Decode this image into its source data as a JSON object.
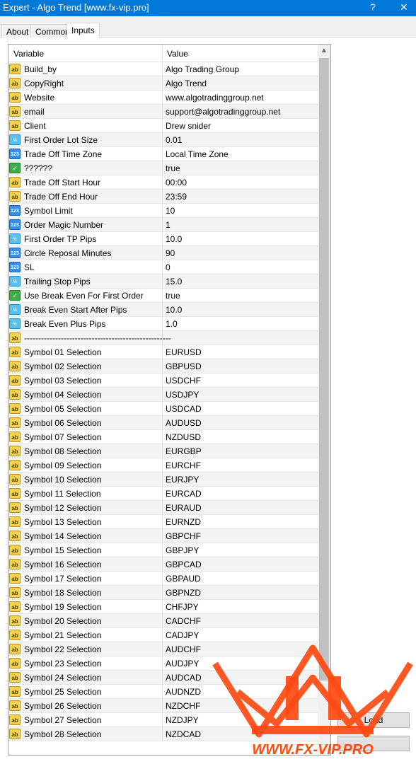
{
  "window": {
    "title": "Expert - Algo Trend [www.fx-vip.pro]",
    "help_glyph": "?",
    "close_glyph": "✕"
  },
  "tabs": [
    {
      "label": "About"
    },
    {
      "label": "Common"
    },
    {
      "label": "Inputs",
      "active": true
    }
  ],
  "grid": {
    "columns": [
      "Variable",
      "Value"
    ],
    "rows": [
      {
        "icon": "ab",
        "variable": "Build_by",
        "value": "Algo Trading Group"
      },
      {
        "icon": "ab",
        "variable": "CopyRight",
        "value": "Algo Trend"
      },
      {
        "icon": "ab",
        "variable": "Website",
        "value": "www.algotradinggroup.net"
      },
      {
        "icon": "ab",
        "variable": "email",
        "value": "support@algotradinggroup.net"
      },
      {
        "icon": "ab",
        "variable": "Client",
        "value": "Drew snider"
      },
      {
        "icon": "dbl",
        "variable": "First Order Lot Size",
        "value": "0.01"
      },
      {
        "icon": "num",
        "variable": "Trade Off Time Zone",
        "value": "Local Time Zone"
      },
      {
        "icon": "bool",
        "variable": "??????",
        "value": "true"
      },
      {
        "icon": "ab",
        "variable": "Trade Off Start Hour",
        "value": "00:00"
      },
      {
        "icon": "ab",
        "variable": "Trade Off End Hour",
        "value": "23:59"
      },
      {
        "icon": "num",
        "variable": "Symbol Limit",
        "value": "10"
      },
      {
        "icon": "num",
        "variable": "Order Magic Number",
        "value": "1"
      },
      {
        "icon": "dbl",
        "variable": "First Order TP Pips",
        "value": "10.0"
      },
      {
        "icon": "num",
        "variable": "Circle Reposal Minutes",
        "value": "90"
      },
      {
        "icon": "num",
        "variable": "SL",
        "value": "0"
      },
      {
        "icon": "dbl",
        "variable": "Trailing Stop Pips",
        "value": "15.0"
      },
      {
        "icon": "bool",
        "variable": "Use Break Even For First Order",
        "value": "true"
      },
      {
        "icon": "dbl",
        "variable": "Break Even Start After Pips",
        "value": "10.0"
      },
      {
        "icon": "dbl",
        "variable": "Break Even Plus Pips",
        "value": "1.0"
      },
      {
        "icon": "ab",
        "variable": "----------------------------------------------------",
        "value": ""
      },
      {
        "icon": "ab",
        "variable": "Symbol 01 Selection",
        "value": "EURUSD"
      },
      {
        "icon": "ab",
        "variable": "Symbol 02 Selection",
        "value": "GBPUSD"
      },
      {
        "icon": "ab",
        "variable": "Symbol 03 Selection",
        "value": "USDCHF"
      },
      {
        "icon": "ab",
        "variable": "Symbol 04 Selection",
        "value": "USDJPY"
      },
      {
        "icon": "ab",
        "variable": "Symbol 05 Selection",
        "value": "USDCAD"
      },
      {
        "icon": "ab",
        "variable": "Symbol 06 Selection",
        "value": "AUDUSD"
      },
      {
        "icon": "ab",
        "variable": "Symbol 07 Selection",
        "value": "NZDUSD"
      },
      {
        "icon": "ab",
        "variable": "Symbol 08 Selection",
        "value": "EURGBP"
      },
      {
        "icon": "ab",
        "variable": "Symbol 09 Selection",
        "value": "EURCHF"
      },
      {
        "icon": "ab",
        "variable": "Symbol 10 Selection",
        "value": "EURJPY"
      },
      {
        "icon": "ab",
        "variable": "Symbol 11 Selection",
        "value": "EURCAD"
      },
      {
        "icon": "ab",
        "variable": "Symbol 12 Selection",
        "value": "EURAUD"
      },
      {
        "icon": "ab",
        "variable": "Symbol 13 Selection",
        "value": "EURNZD"
      },
      {
        "icon": "ab",
        "variable": "Symbol 14 Selection",
        "value": "GBPCHF"
      },
      {
        "icon": "ab",
        "variable": "Symbol 15 Selection",
        "value": "GBPJPY"
      },
      {
        "icon": "ab",
        "variable": "Symbol 16 Selection",
        "value": "GBPCAD"
      },
      {
        "icon": "ab",
        "variable": "Symbol 17 Selection",
        "value": "GBPAUD"
      },
      {
        "icon": "ab",
        "variable": "Symbol 18 Selection",
        "value": "GBPNZD"
      },
      {
        "icon": "ab",
        "variable": "Symbol 19 Selection",
        "value": "CHFJPY"
      },
      {
        "icon": "ab",
        "variable": "Symbol 20 Selection",
        "value": "CADCHF"
      },
      {
        "icon": "ab",
        "variable": "Symbol 21 Selection",
        "value": "CADJPY"
      },
      {
        "icon": "ab",
        "variable": "Symbol 22 Selection",
        "value": "AUDCHF"
      },
      {
        "icon": "ab",
        "variable": "Symbol 23 Selection",
        "value": "AUDJPY"
      },
      {
        "icon": "ab",
        "variable": "Symbol 24 Selection",
        "value": "AUDCAD"
      },
      {
        "icon": "ab",
        "variable": "Symbol 25 Selection",
        "value": "AUDNZD"
      },
      {
        "icon": "ab",
        "variable": "Symbol 26 Selection",
        "value": "NZDCHF"
      },
      {
        "icon": "ab",
        "variable": "Symbol 27 Selection",
        "value": "NZDJPY"
      },
      {
        "icon": "ab",
        "variable": "Symbol 28 Selection",
        "value": "NZDCAD"
      }
    ]
  },
  "icon_glyphs": {
    "ab": "ab",
    "num": "123",
    "dbl": "½",
    "bool": "✓"
  },
  "buttons": {
    "load_label": "Load",
    "save_label": ""
  },
  "watermark": {
    "text": "WWW.FX-VIP.PRO",
    "color": "#ff4a12"
  }
}
